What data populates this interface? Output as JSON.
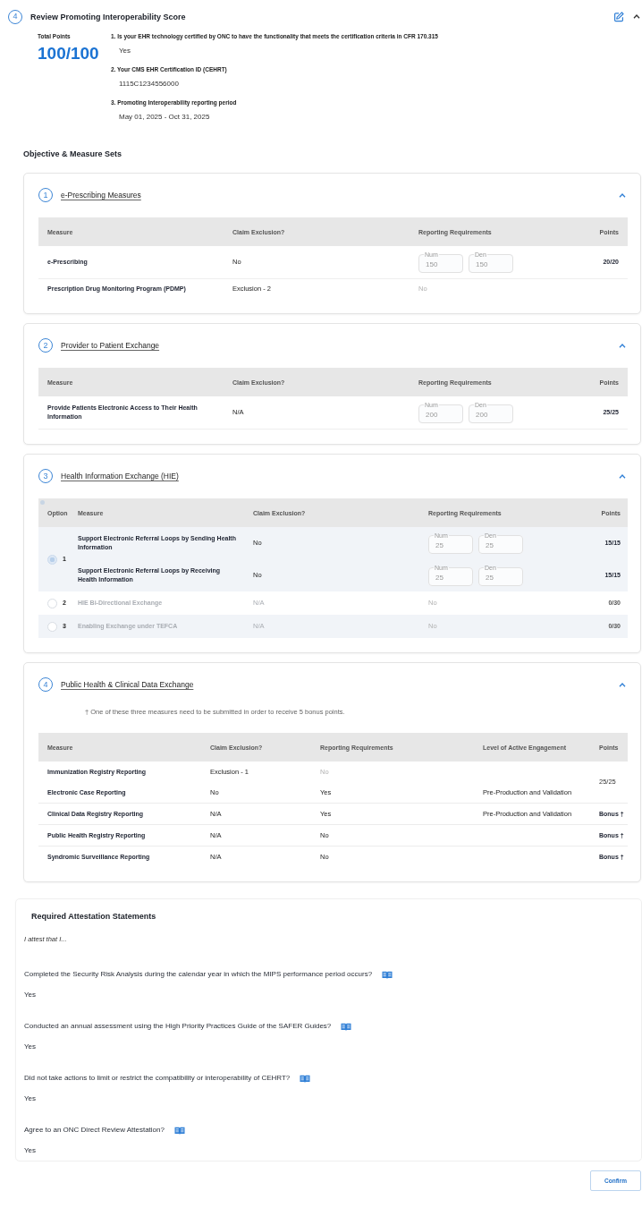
{
  "header": {
    "step": "4",
    "title": "Review Promoting Interoperability Score",
    "expanded": true
  },
  "score": {
    "label": "Total Points",
    "value": "100/100"
  },
  "questions": [
    {
      "question": "1. Is your EHR technology certified by ONC to have the functionality that meets the certification criteria in CFR 170.315",
      "answer": "Yes"
    },
    {
      "question": "2. Your CMS EHR Certification ID (CEHRT)",
      "answer": "1115C1234556000"
    },
    {
      "question": "3. Promoting Interoperability reporting period",
      "answer": "May 01, 2025 - Oct 31, 2025"
    }
  ],
  "objectives": {
    "title": "Objective & Measure Sets",
    "sections": [
      {
        "kind": "measures",
        "step": "1",
        "title": "e-Prescribing Measures",
        "expanded": true,
        "columns": [
          "Measure",
          "Claim Exclusion?",
          "Reporting Requirements",
          "Points"
        ],
        "rows": [
          {
            "measure": "e-Prescribing",
            "claim_exclusion": "No",
            "reporting": {
              "kind": "counts",
              "numerator_label": "Num",
              "numerator": "150",
              "denominator_label": "Den",
              "denominator": "150"
            },
            "points": "20/20"
          },
          {
            "measure": "Prescription Drug Monitoring Program (PDMP)",
            "claim_exclusion": "Exclusion - 2",
            "reporting": {
              "kind": "answer",
              "text": "No",
              "disabled": true
            }
          }
        ]
      },
      {
        "kind": "measures",
        "step": "2",
        "title": "Provider to Patient Exchange",
        "expanded": true,
        "columns": [
          "Measure",
          "Claim Exclusion?",
          "Reporting Requirements",
          "Points"
        ],
        "rows": [
          {
            "measure": "Provide Patients Electronic Access to Their Health Information",
            "claim_exclusion": "N/A",
            "reporting": {
              "kind": "counts",
              "numerator_label": "Num",
              "numerator": "200",
              "denominator_label": "Den",
              "denominator": "200"
            },
            "points": "25/25"
          }
        ]
      },
      {
        "kind": "options",
        "step": "3",
        "title": "Health Information Exchange (HIE)",
        "expanded": true,
        "columns": [
          "Option",
          "Measure",
          "Claim Exclusion?",
          "Reporting Requirements",
          "Points"
        ],
        "options": [
          {
            "label": "1",
            "selected": true,
            "rows": [
              {
                "measure": "Support Electronic Referral Loops by Sending Health Information",
                "claim_exclusion": "No",
                "reporting": {
                  "kind": "counts",
                  "numerator_label": "Num",
                  "numerator": "25",
                  "denominator_label": "Den",
                  "denominator": "25"
                },
                "points": "15/15"
              },
              {
                "measure": "Support Electronic Referral Loops by Receiving Health Information",
                "claim_exclusion": "No",
                "reporting": {
                  "kind": "counts",
                  "numerator_label": "Num",
                  "numerator": "25",
                  "denominator_label": "Den",
                  "denominator": "25"
                },
                "points": "15/15"
              }
            ]
          },
          {
            "label": "2",
            "selected": false,
            "rows": [
              {
                "measure": "HIE Bi-Directional Exchange",
                "claim_exclusion": "N/A",
                "reporting": {
                  "kind": "answer",
                  "text": "No",
                  "disabled": true
                },
                "points": "0/30"
              }
            ]
          },
          {
            "label": "3",
            "selected": false,
            "rows": [
              {
                "measure": "Enabling Exchange under TEFCA",
                "claim_exclusion": "N/A",
                "reporting": {
                  "kind": "answer",
                  "text": "No",
                  "disabled": true
                },
                "points": "0/30"
              }
            ]
          }
        ]
      },
      {
        "kind": "engagement",
        "step": "4",
        "title": "Public Health & Clinical Data Exchange",
        "expanded": true,
        "note": "† One of these three measures need to be submitted in order to receive 5 bonus points.",
        "columns": [
          "Measure",
          "Claim Exclusion?",
          "Reporting Requirements",
          "Level of Active Engagement",
          "Points"
        ],
        "groups": [
          {
            "points": "25/25",
            "emphasized": false,
            "rows": [
              {
                "measure": "Immunization Registry Reporting",
                "claim_exclusion": "Exclusion - 1",
                "reporting": {
                  "kind": "answer",
                  "text": "No",
                  "disabled": true
                }
              },
              {
                "measure": "Electronic Case Reporting",
                "claim_exclusion": "No",
                "reporting": {
                  "kind": "answer",
                  "text": "Yes",
                  "disabled": false
                },
                "engagement": "Pre-Production and Validation"
              }
            ]
          },
          {
            "points": "Bonus †",
            "emphasized": true,
            "rows": [
              {
                "measure": "Clinical Data Registry Reporting",
                "claim_exclusion": "N/A",
                "reporting": {
                  "kind": "answer",
                  "text": "Yes",
                  "disabled": false
                },
                "engagement": "Pre-Production and Validation"
              }
            ]
          },
          {
            "points": "Bonus †",
            "emphasized": true,
            "rows": [
              {
                "measure": "Public Health Registry Reporting",
                "claim_exclusion": "N/A",
                "reporting": {
                  "kind": "answer",
                  "text": "No",
                  "disabled": false
                }
              }
            ]
          },
          {
            "points": "Bonus †",
            "emphasized": true,
            "rows": [
              {
                "measure": "Syndromic Surveillance Reporting",
                "claim_exclusion": "N/A",
                "reporting": {
                  "kind": "answer",
                  "text": "No",
                  "disabled": false
                }
              }
            ]
          }
        ]
      }
    ]
  },
  "attestation": {
    "title": "Required Attestation Statements",
    "intro": "I attest that I...",
    "statements": [
      {
        "question": "Completed the Security Risk Analysis during the calendar year in which the MIPS performance period occurs?",
        "answer": "Yes"
      },
      {
        "question": "Conducted an annual assessment using the High Priority Practices Guide of the SAFER Guides?",
        "answer": "Yes"
      },
      {
        "question": "Did not take actions to limit or restrict the compatibility or interoperability of CEHRT?",
        "answer": "Yes"
      },
      {
        "question": "Agree to an ONC Direct Review Attestation?",
        "answer": "Yes"
      }
    ]
  },
  "confirm_button": {
    "label": "Confirm"
  }
}
